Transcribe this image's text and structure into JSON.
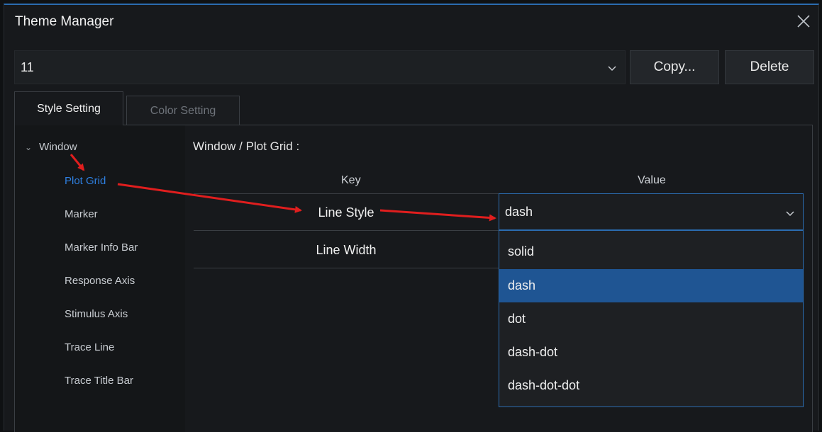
{
  "window": {
    "title": "Theme Manager"
  },
  "theme_selector": {
    "value": "11"
  },
  "buttons": {
    "copy": "Copy...",
    "delete": "Delete"
  },
  "tabs": [
    {
      "label": "Style Setting",
      "active": true
    },
    {
      "label": "Color Setting",
      "active": false
    }
  ],
  "tree": {
    "group": "Window",
    "items": [
      {
        "label": "Plot Grid",
        "selected": true
      },
      {
        "label": "Marker"
      },
      {
        "label": "Marker Info Bar"
      },
      {
        "label": "Response Axis"
      },
      {
        "label": "Stimulus Axis"
      },
      {
        "label": "Trace Line"
      },
      {
        "label": "Trace Title Bar"
      }
    ]
  },
  "detail": {
    "title": "Window / Plot Grid :",
    "columns": {
      "key": "Key",
      "value": "Value"
    },
    "rows": [
      {
        "key": "Line Style",
        "value": "dash"
      },
      {
        "key": "Line Width"
      }
    ]
  },
  "dropdown": {
    "options": [
      "solid",
      "dash",
      "dot",
      "dash-dot",
      "dash-dot-dot"
    ],
    "selected": "dash"
  },
  "colors": {
    "accent": "#2b6cb0",
    "selected_option": "#1f5593",
    "annotation": "#e01e1e"
  },
  "icons": [
    "close-icon",
    "chevron-down-icon",
    "tree-expand-icon"
  ]
}
